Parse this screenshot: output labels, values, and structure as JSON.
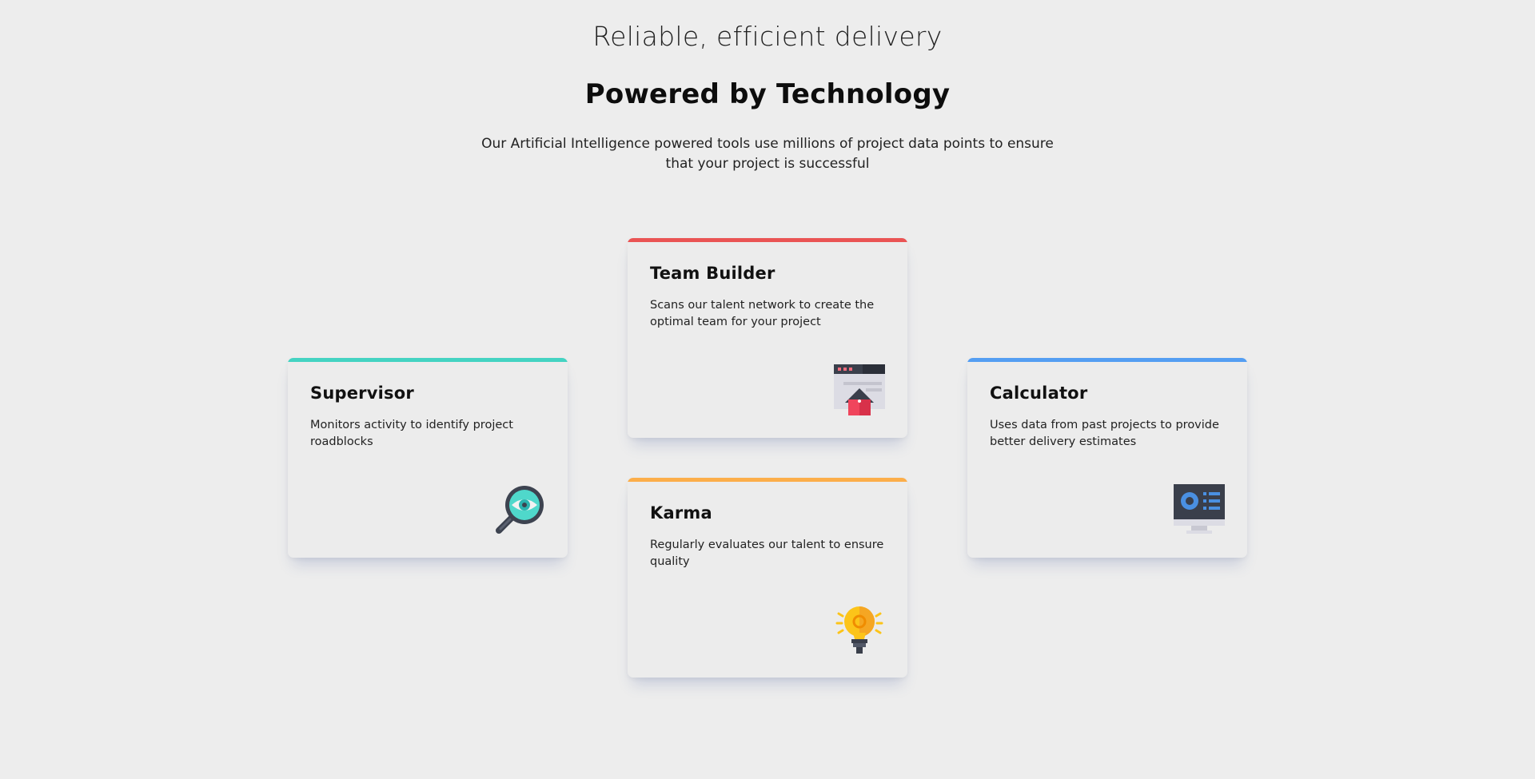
{
  "header": {
    "subtitle": "Reliable, efficient delivery",
    "headline": "Powered by Technology",
    "intro": "Our Artificial Intelligence powered tools use millions of project data points to ensure that your project is successful"
  },
  "cards": {
    "supervisor": {
      "title": "Supervisor",
      "description": "Monitors activity to identify project roadblocks",
      "icon": "magnifier-eye-icon",
      "accent": "#44d3c2"
    },
    "team_builder": {
      "title": "Team Builder",
      "description": "Scans our talent network to create the optimal team for your project",
      "icon": "team-builder-house-icon",
      "accent": "#ea5454"
    },
    "karma": {
      "title": "Karma",
      "description": "Regularly evaluates our talent to ensure quality",
      "icon": "lightbulb-icon",
      "accent": "#fcae4a"
    },
    "calculator": {
      "title": "Calculator",
      "description": "Uses data from past projects to provide better delivery estimates",
      "icon": "monitor-chart-icon",
      "accent": "#549ef2"
    }
  }
}
